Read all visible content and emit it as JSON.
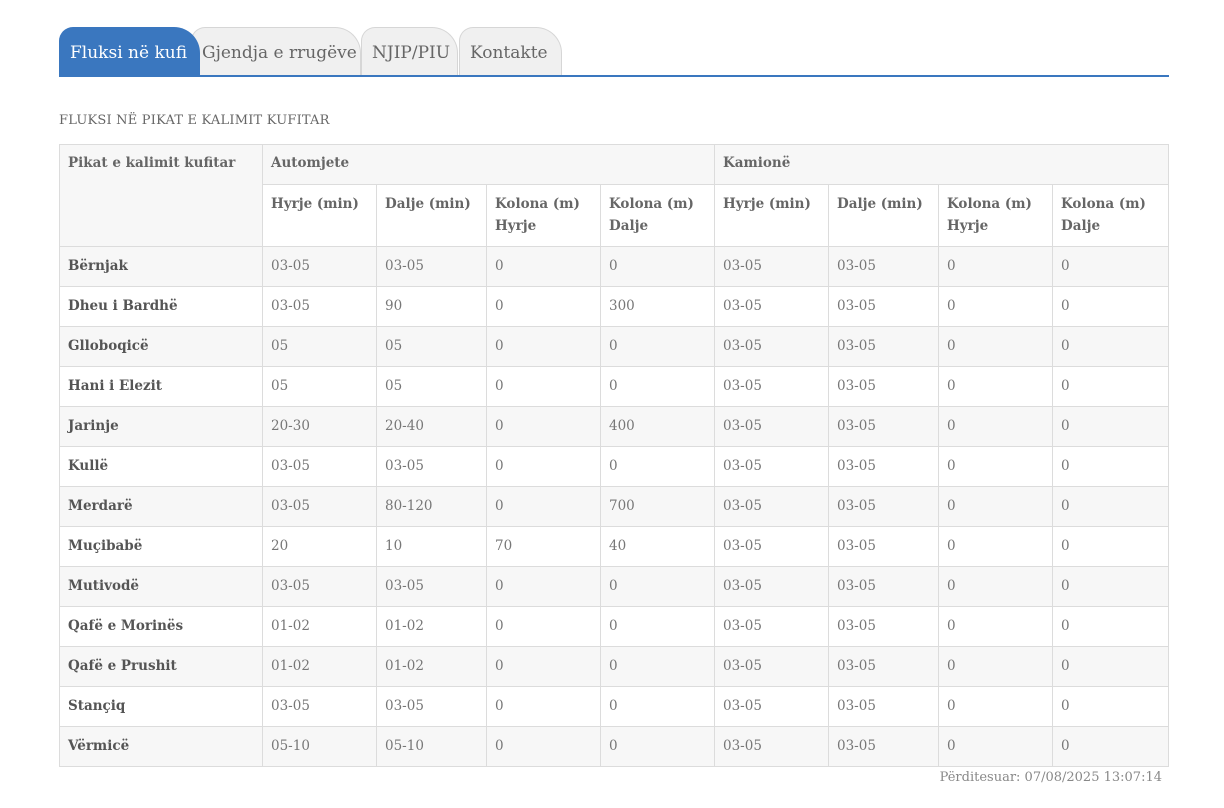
{
  "tabs": [
    {
      "label": "Fluksi në kufi",
      "active": true
    },
    {
      "label": "Gjendja e rrugëve",
      "active": false
    },
    {
      "label": "NJIP/PIU",
      "active": false
    },
    {
      "label": "Kontakte",
      "active": false
    }
  ],
  "section_title": "FLUKSI NË PIKAT E KALIMIT KUFITAR",
  "table": {
    "corner_header": "Pikat e kalimit kufitar",
    "group_headers": [
      "Automjete",
      "Kamionë"
    ],
    "sub_headers": [
      "Hyrje (min)",
      "Dalje (min)",
      "Kolona (m) Hyrje",
      "Kolona (m) Dalje",
      "Hyrje (min)",
      "Dalje (min)",
      "Kolona (m) Hyrje",
      "Kolona (m) Dalje"
    ],
    "rows": [
      {
        "name": "Bërnjak",
        "values": [
          "03-05",
          "03-05",
          "0",
          "0",
          "03-05",
          "03-05",
          "0",
          "0"
        ]
      },
      {
        "name": "Dheu i Bardhë",
        "values": [
          "03-05",
          "90",
          "0",
          "300",
          "03-05",
          "03-05",
          "0",
          "0"
        ]
      },
      {
        "name": "Glloboqicë",
        "values": [
          "05",
          "05",
          "0",
          "0",
          "03-05",
          "03-05",
          "0",
          "0"
        ]
      },
      {
        "name": "Hani i Elezit",
        "values": [
          "05",
          "05",
          "0",
          "0",
          "03-05",
          "03-05",
          "0",
          "0"
        ]
      },
      {
        "name": "Jarinje",
        "values": [
          "20-30",
          "20-40",
          "0",
          "400",
          "03-05",
          "03-05",
          "0",
          "0"
        ]
      },
      {
        "name": "Kullë",
        "values": [
          "03-05",
          "03-05",
          "0",
          "0",
          "03-05",
          "03-05",
          "0",
          "0"
        ]
      },
      {
        "name": "Merdarë",
        "values": [
          "03-05",
          "80-120",
          "0",
          "700",
          "03-05",
          "03-05",
          "0",
          "0"
        ]
      },
      {
        "name": "Muçibabë",
        "values": [
          "20",
          "10",
          "70",
          "40",
          "03-05",
          "03-05",
          "0",
          "0"
        ]
      },
      {
        "name": "Mutivodë",
        "values": [
          "03-05",
          "03-05",
          "0",
          "0",
          "03-05",
          "03-05",
          "0",
          "0"
        ]
      },
      {
        "name": "Qafë e Morinës",
        "values": [
          "01-02",
          "01-02",
          "0",
          "0",
          "03-05",
          "03-05",
          "0",
          "0"
        ]
      },
      {
        "name": "Qafë e Prushit",
        "values": [
          "01-02",
          "01-02",
          "0",
          "0",
          "03-05",
          "03-05",
          "0",
          "0"
        ]
      },
      {
        "name": "Stançiq",
        "values": [
          "03-05",
          "03-05",
          "0",
          "0",
          "03-05",
          "03-05",
          "0",
          "0"
        ]
      },
      {
        "name": "Vërmicë",
        "values": [
          "05-10",
          "05-10",
          "0",
          "0",
          "03-05",
          "03-05",
          "0",
          "0"
        ]
      }
    ]
  },
  "updated_text": "Përditesuar: 07/08/2025 13:07:14",
  "colors": {
    "accent": "#3a77bf",
    "row_stripe": "#f7f7f7",
    "border": "#dcdcdc"
  }
}
